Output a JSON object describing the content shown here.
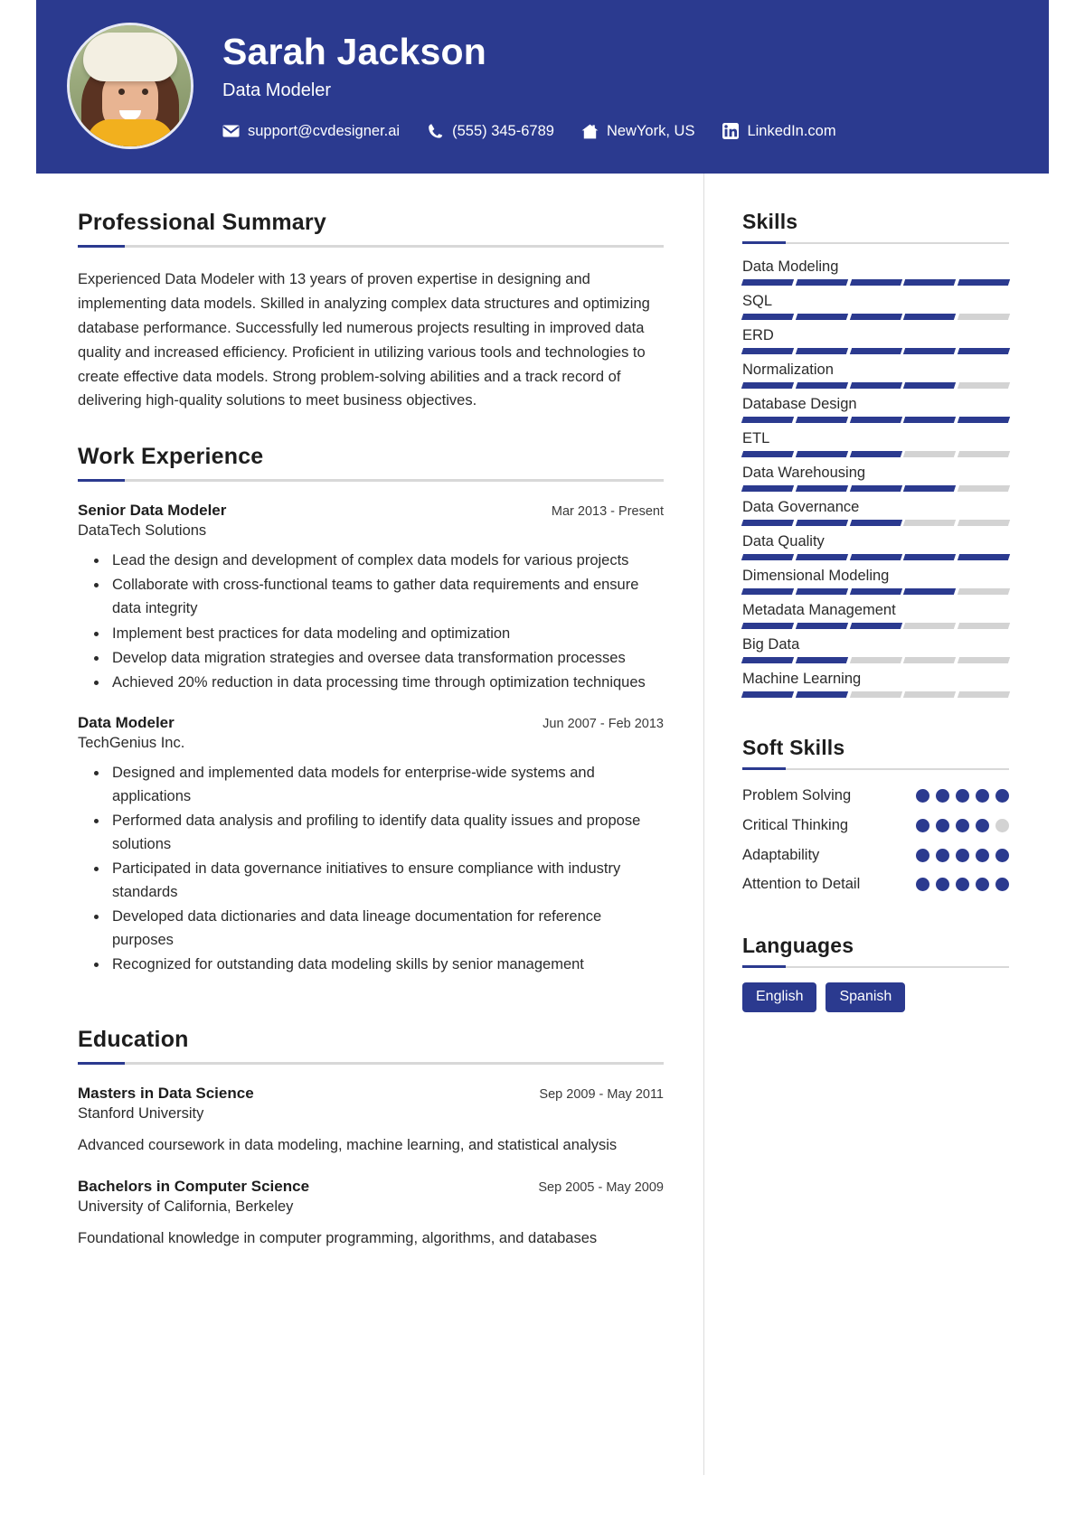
{
  "theme": {
    "primary": "#2b3a8f",
    "bar_empty": "#d3d3d3",
    "rule": "#d8d8d8"
  },
  "header": {
    "name": "Sarah Jackson",
    "role": "Data Modeler",
    "avatar_alt": "profile-photo",
    "contacts": [
      {
        "icon": "envelope-icon",
        "text": "support@cvdesigner.ai"
      },
      {
        "icon": "phone-icon",
        "text": "(555) 345-6789"
      },
      {
        "icon": "home-icon",
        "text": "NewYork, US"
      },
      {
        "icon": "linkedin-icon",
        "text": "LinkedIn.com"
      }
    ]
  },
  "left": {
    "summary": {
      "title": "Professional Summary",
      "text": "Experienced Data Modeler with 13 years of proven expertise in designing and implementing data models. Skilled in analyzing complex data structures and optimizing database performance. Successfully led numerous projects resulting in improved data quality and increased efficiency. Proficient in utilizing various tools and technologies to create effective data models. Strong problem-solving abilities and a track record of delivering high-quality solutions to meet business objectives."
    },
    "experience": {
      "title": "Work Experience",
      "items": [
        {
          "job_title": "Senior Data Modeler",
          "date": "Mar 2013 - Present",
          "company": "DataTech Solutions",
          "bullets": [
            "Lead the design and development of complex data models for various projects",
            "Collaborate with cross-functional teams to gather data requirements and ensure data integrity",
            "Implement best practices for data modeling and optimization",
            "Develop data migration strategies and oversee data transformation processes",
            "Achieved 20% reduction in data processing time through optimization techniques"
          ]
        },
        {
          "job_title": "Data Modeler",
          "date": "Jun 2007 - Feb 2013",
          "company": "TechGenius Inc.",
          "bullets": [
            "Designed and implemented data models for enterprise-wide systems and applications",
            "Performed data analysis and profiling to identify data quality issues and propose solutions",
            "Participated in data governance initiatives to ensure compliance with industry standards",
            "Developed data dictionaries and data lineage documentation for reference purposes",
            "Recognized for outstanding data modeling skills by senior management"
          ]
        }
      ]
    },
    "education": {
      "title": "Education",
      "items": [
        {
          "degree": "Masters in Data Science",
          "date": "Sep 2009 - May 2011",
          "school": "Stanford University",
          "description": "Advanced coursework in data modeling, machine learning, and statistical analysis"
        },
        {
          "degree": "Bachelors in Computer Science",
          "date": "Sep 2005 - May 2009",
          "school": "University of California, Berkeley",
          "description": "Foundational knowledge in computer programming, algorithms, and databases"
        }
      ]
    }
  },
  "right": {
    "skills": {
      "title": "Skills",
      "max_level": 5,
      "items": [
        {
          "name": "Data Modeling",
          "level": 5
        },
        {
          "name": "SQL",
          "level": 4
        },
        {
          "name": "ERD",
          "level": 5
        },
        {
          "name": "Normalization",
          "level": 4
        },
        {
          "name": "Database Design",
          "level": 5
        },
        {
          "name": "ETL",
          "level": 3
        },
        {
          "name": "Data Warehousing",
          "level": 4
        },
        {
          "name": "Data Governance",
          "level": 3
        },
        {
          "name": "Data Quality",
          "level": 5
        },
        {
          "name": "Dimensional Modeling",
          "level": 4
        },
        {
          "name": "Metadata Management",
          "level": 3
        },
        {
          "name": "Big Data",
          "level": 2
        },
        {
          "name": "Machine Learning",
          "level": 2
        }
      ]
    },
    "soft_skills": {
      "title": "Soft Skills",
      "max_level": 5,
      "items": [
        {
          "name": "Problem Solving",
          "level": 5
        },
        {
          "name": "Critical Thinking",
          "level": 4
        },
        {
          "name": "Adaptability",
          "level": 5
        },
        {
          "name": "Attention to Detail",
          "level": 5
        }
      ]
    },
    "languages": {
      "title": "Languages",
      "items": [
        "English",
        "Spanish"
      ]
    }
  }
}
